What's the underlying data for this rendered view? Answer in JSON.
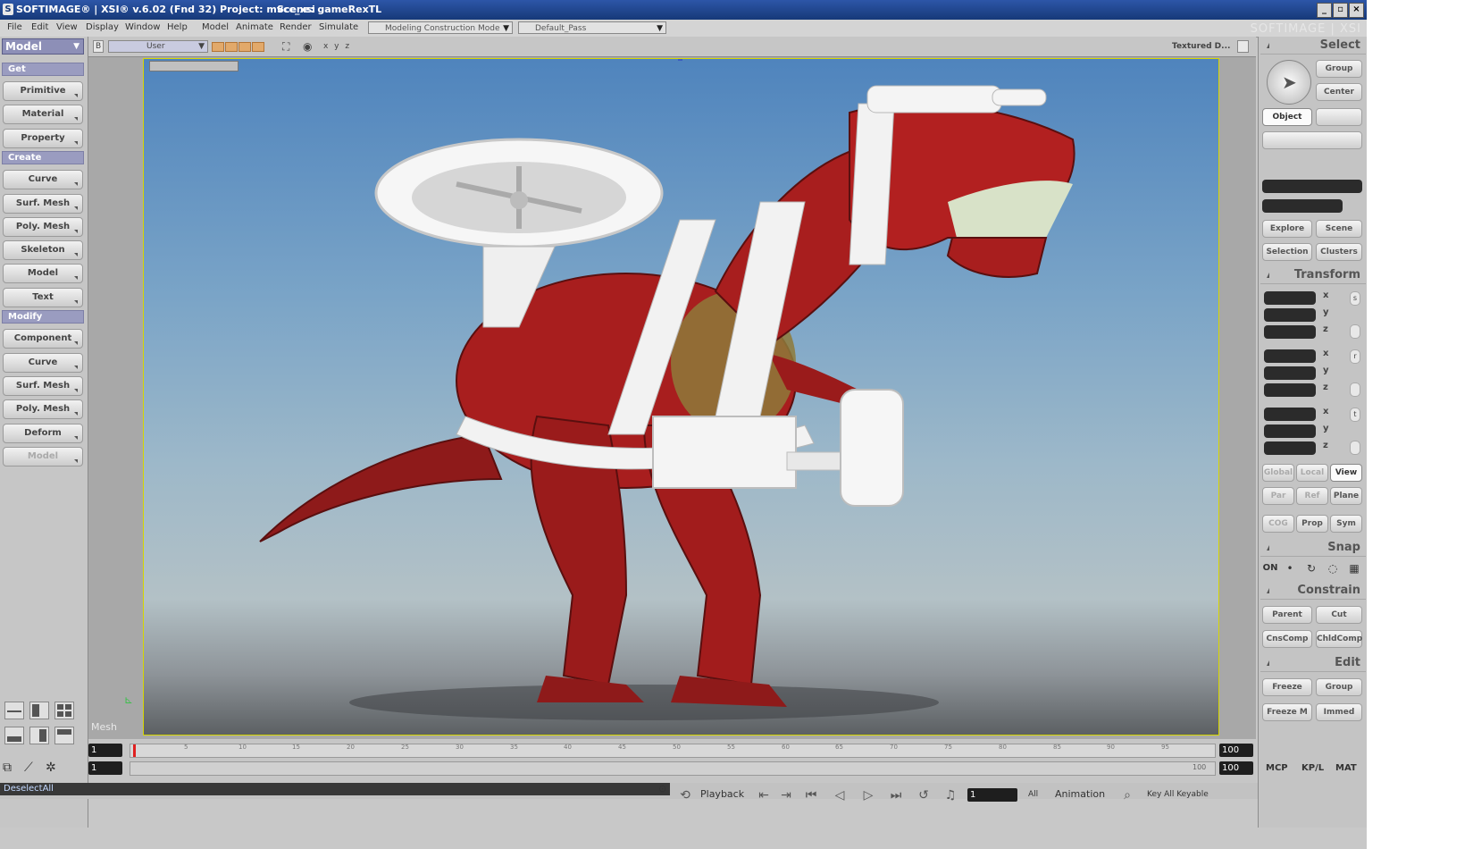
{
  "window": {
    "title": "SOFTIMAGE® | XSI® v.6.02 (Fnd 32) Project: mvcc_xsi",
    "scene": "Scene: gameRexTL",
    "controls": [
      "_",
      "▫",
      "×"
    ],
    "watermark": "SOFTIMAGE | XSI"
  },
  "menubar": {
    "items": [
      "File",
      "Edit",
      "View",
      "Display",
      "Window",
      "Help",
      "Model",
      "Animate",
      "Render",
      "Simulate"
    ],
    "mode": "Modeling Construction Mode",
    "pass": "Default_Pass"
  },
  "left_panel": {
    "module": "Model",
    "sections": {
      "get": "Get",
      "create": "Create",
      "modify": "Modify"
    },
    "get_buttons": [
      "Primitive",
      "Material",
      "Property"
    ],
    "create_buttons": [
      "Curve",
      "Surf. Mesh",
      "Poly. Mesh",
      "Skeleton",
      "Model",
      "Text"
    ],
    "modify_buttons": [
      "Component",
      "Curve",
      "Surf. Mesh",
      "Poly. Mesh",
      "Deform",
      "Model"
    ]
  },
  "viewport": {
    "letter": "B",
    "camera": "User",
    "axes": "x y z",
    "display_mode": "Textured D...",
    "label": "Mesh"
  },
  "timeline": {
    "start_frame": "1",
    "end_frame": "100",
    "range_start": "1",
    "range_end": "100",
    "range_end_2": "100",
    "ticks": [
      "5",
      "10",
      "15",
      "20",
      "25",
      "30",
      "35",
      "40",
      "45",
      "50",
      "55",
      "60",
      "65",
      "70",
      "75",
      "80",
      "85",
      "90",
      "95"
    ]
  },
  "statusbar": {
    "command": "DeselectAll",
    "playback": "Playback",
    "frame_field": "1",
    "all": "All",
    "animation": "Animation",
    "key_label": "Key All Keyable"
  },
  "right_panel": {
    "select": {
      "header": "Select",
      "group": "Group",
      "center": "Center",
      "object": "Object",
      "explore": "Explore",
      "scene": "Scene",
      "selection": "Selection",
      "clusters": "Clusters"
    },
    "transform": {
      "header": "Transform",
      "axes": [
        "x",
        "y",
        "z"
      ],
      "side_icons": [
        "s",
        "r",
        "t"
      ],
      "global": "Global",
      "local": "Local",
      "view": "View",
      "par": "Par",
      "ref": "Ref",
      "plane": "Plane",
      "cog": "COG",
      "prop": "Prop",
      "sym": "Sym"
    },
    "snap": {
      "header": "Snap",
      "on": "ON"
    },
    "constrain": {
      "header": "Constrain",
      "parent": "Parent",
      "cut": "Cut",
      "cnscomp": "CnsComp",
      "childcomp": "ChldComp"
    },
    "edit": {
      "header": "Edit",
      "freeze": "Freeze",
      "group": "Group",
      "freeze_m": "Freeze M",
      "immed": "Immed"
    },
    "bottom_tabs": [
      "MCP",
      "KP/L",
      "MAT"
    ]
  },
  "colors": {
    "title_bar": "#1f4a9a",
    "section_header": "#9a9cc0",
    "viewport_border": "#d6d600",
    "sky_top": "#4f84bd",
    "rex_red": "#a81e1e"
  }
}
